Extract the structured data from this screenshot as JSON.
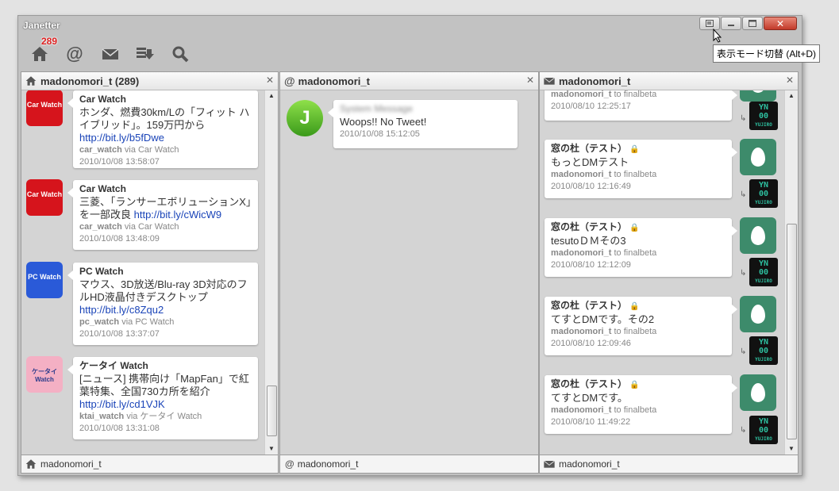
{
  "app": {
    "title": "Janetter",
    "badge": "289"
  },
  "tooltip": "表示モード切替 (Alt+D)",
  "columns": [
    {
      "title": "madonomori_t (289)",
      "footer": "madonomori_t"
    },
    {
      "title": "madonomori_t",
      "footer": "madonomori_t"
    },
    {
      "title": "madonomori_t",
      "footer": "madonomori_t"
    }
  ],
  "col1": [
    {
      "avatar": "Car Watch",
      "name": "Car Watch",
      "text": "ホンダ、燃費30km/Lの「フィット ハイブリッド」。159万円から ",
      "link": "http://bit.ly/b5fDwe",
      "user": "car_watch",
      "via": "via Car Watch",
      "date": "2010/10/08  13:58:07"
    },
    {
      "avatar": "Car Watch",
      "name": "Car Watch",
      "text": "三菱、「ランサーエボリューションX」を一部改良 ",
      "link": "http://bit.ly/cWicW9",
      "user": "car_watch",
      "via": "via Car Watch",
      "date": "2010/10/08  13:48:09"
    },
    {
      "avatar": "PC Watch",
      "name": "PC Watch",
      "text": "マウス、3D放送/Blu-ray 3D対応のフルHD液晶付きデスクトップ ",
      "link": "http://bit.ly/c8Zqu2",
      "user": "pc_watch",
      "via": "via PC Watch",
      "date": "2010/10/08  13:37:07"
    },
    {
      "avatar": "ケータイ Watch",
      "name": "ケータイ Watch",
      "text": "[ニュース] 携帯向け「MapFan」で紅葉特集、全国730カ所を紹介 ",
      "link": "http://bit.ly/cd1VJK",
      "user": "ktai_watch",
      "via": "via ケータイ Watch",
      "date": "2010/10/08  13:31:08"
    }
  ],
  "col2": [
    {
      "name": "System Message",
      "text": "Woops!! No Tweet!",
      "date": "2010/10/08  15:12:05"
    }
  ],
  "col3_top": {
    "user": "madonomori_t",
    "to": "to finalbeta",
    "date": "2010/08/10  12:25:17"
  },
  "col3": [
    {
      "name": "窓の杜（テスト）",
      "text": "もっとDMテスト",
      "user": "madonomori_t",
      "to": "to finalbeta",
      "date": "2010/08/10  12:16:49"
    },
    {
      "name": "窓の杜（テスト）",
      "text": "tesutoＤＭその3",
      "user": "madonomori_t",
      "to": "to finalbeta",
      "date": "2010/08/10  12:12:09"
    },
    {
      "name": "窓の杜（テスト）",
      "text": "てすとDMです。その2",
      "user": "madonomori_t",
      "to": "to finalbeta",
      "date": "2010/08/10  12:09:46"
    },
    {
      "name": "窓の杜（テスト）",
      "text": "てすとDMです。",
      "user": "madonomori_t",
      "to": "to finalbeta",
      "date": "2010/08/10  11:49:22"
    }
  ],
  "yn": {
    "line1": "YN",
    "line2": "00",
    "line3": "YUJIRO"
  }
}
